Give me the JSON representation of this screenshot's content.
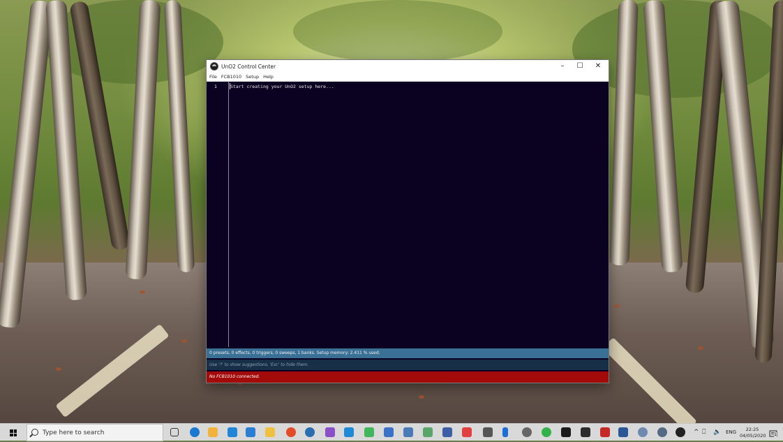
{
  "window": {
    "title": "UnO2 Control Center",
    "controls": {
      "minimize": "–",
      "maximize": "☐",
      "close": "✕"
    },
    "menu": [
      "File",
      "FCB1010",
      "Setup",
      "Help"
    ],
    "editor": {
      "line_numbers": [
        "1"
      ],
      "lines": [
        "Start creating your UnO2 setup here..."
      ]
    },
    "status_info": "0 presets, 0 effects, 0 triggers, 0 sweeps, 1 banks. Setup memory: 2.411 % used.",
    "hint": "Use '?' to show suggestions, 'Esc' to hide them.",
    "error": "No FCB1010 connected."
  },
  "taskbar": {
    "search_placeholder": "Type here to search",
    "pinned_icons": [
      "task-view-icon",
      "edge-icon",
      "store-icon",
      "app-l-icon",
      "mail-icon",
      "folder-icon",
      "chrome-icon",
      "browser-icon",
      "visual-studio-icon",
      "vscode-icon",
      "qt-icon",
      "photos-icon",
      "cube-icon",
      "python-icon",
      "app-grid-icon",
      "video-icon",
      "calculator-icon",
      "phone-icon",
      "settings-icon",
      "spotify-icon",
      "terminal-icon",
      "console-icon",
      "filezilla-icon",
      "word-icon",
      "cloud-icon",
      "onedrive-icon",
      "steam-icon"
    ],
    "tray": {
      "chevron": "^",
      "network": "⎕",
      "volume": "🔈",
      "language": "ENG"
    },
    "time": "22:25",
    "date": "04/05/2020",
    "notification_count": "1"
  },
  "colors": {
    "editor_bg": "#0b0221",
    "status_info_bg": "#3a7096",
    "hint_bg": "#173048",
    "error_bg": "#a30b0b",
    "taskbar_bg": "#d9d9d9"
  }
}
